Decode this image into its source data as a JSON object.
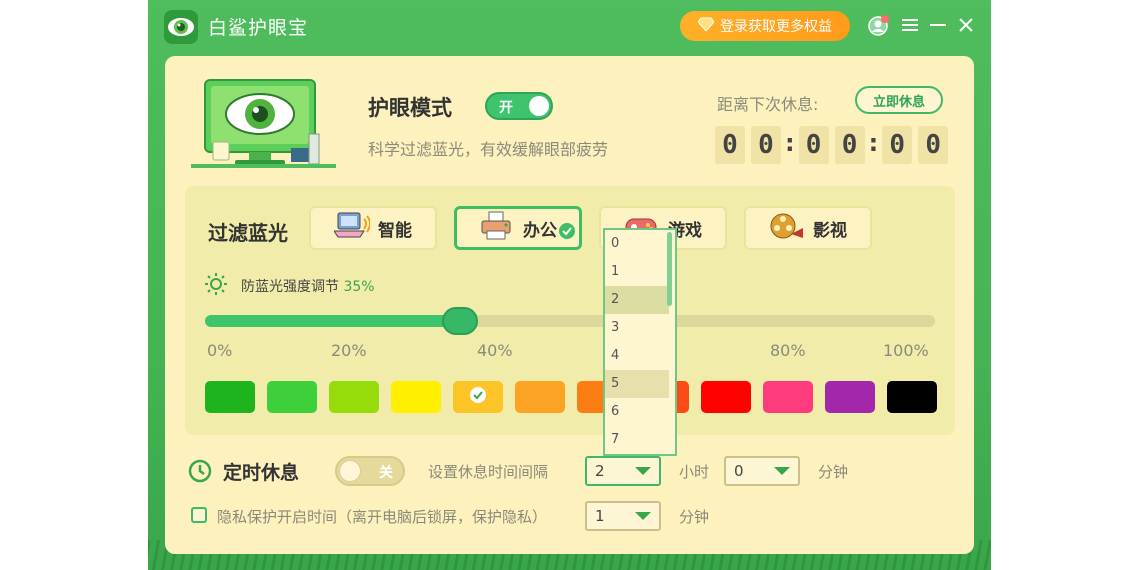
{
  "app": {
    "title": "白鲨护眼宝",
    "vip_button": "登录获取更多权益"
  },
  "eye_mode": {
    "title": "护眼模式",
    "toggle_label": "开",
    "description": "科学过滤蓝光，有效缓解眼部疲劳"
  },
  "rest": {
    "label": "距离下次休息:",
    "button": "立即休息",
    "digits": [
      "0",
      "0",
      "0",
      "0",
      "0",
      "0"
    ]
  },
  "filter": {
    "title": "过滤蓝光",
    "modes": [
      {
        "label": "智能",
        "icon": "computer-icon",
        "selected": false
      },
      {
        "label": "办公",
        "icon": "printer-icon",
        "selected": true
      },
      {
        "label": "游戏",
        "icon": "game-icon",
        "selected": false
      },
      {
        "label": "影视",
        "icon": "film-reel-icon",
        "selected": false
      }
    ],
    "strength_label": "防蓝光强度调节",
    "strength_value": "35%",
    "strength_fraction": 0.35,
    "ticks": [
      "0%",
      "20%",
      "40%",
      "80%",
      "100%"
    ],
    "colors": [
      "#1eb41e",
      "#3ed03a",
      "#96dc0a",
      "#ffef00",
      "#fcc427",
      "#fda324",
      "#fb7d14",
      "#fb4b16",
      "#fe0202",
      "#fe3b7c",
      "#a327ab",
      "#000000"
    ],
    "selected_color_index": 4
  },
  "timer": {
    "title": "定时休息",
    "toggle_label": "关",
    "interval_label": "设置休息时间间隔",
    "hours_value": "2",
    "hours_unit": "小时",
    "minutes_value": "0",
    "minutes_unit": "分钟"
  },
  "privacy": {
    "label": "隐私保护开启时间（离开电脑后锁屏，保护隐私）",
    "value": "1",
    "unit": "分钟"
  },
  "dropdown": {
    "options": [
      "0",
      "1",
      "2",
      "3",
      "4",
      "5",
      "6",
      "7"
    ],
    "selected_index": 2,
    "hover_index": 5
  }
}
